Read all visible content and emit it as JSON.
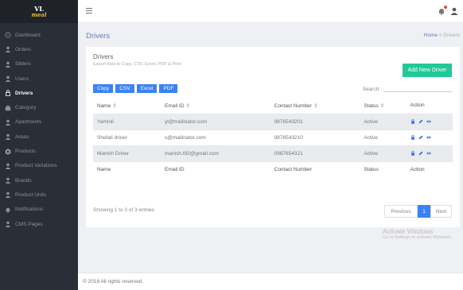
{
  "app": {
    "logo_top": "VL",
    "logo_bottom": "meal"
  },
  "sidebar": {
    "items": [
      {
        "label": "Dashboard",
        "icon": "dashboard-icon"
      },
      {
        "label": "Orders",
        "icon": "user-icon"
      },
      {
        "label": "Sliders",
        "icon": "user-icon"
      },
      {
        "label": "Users",
        "icon": "user-icon"
      },
      {
        "label": "Drivers",
        "icon": "lock-icon",
        "active": true
      },
      {
        "label": "Category",
        "icon": "category-icon"
      },
      {
        "label": "Apartments",
        "icon": "user-icon"
      },
      {
        "label": "Areas",
        "icon": "user-icon"
      },
      {
        "label": "Products",
        "icon": "product-icon"
      },
      {
        "label": "Product Variations",
        "icon": "user-icon"
      },
      {
        "label": "Brands",
        "icon": "user-icon"
      },
      {
        "label": "Product Units",
        "icon": "user-icon"
      },
      {
        "label": "Notifications",
        "icon": "bell-icon"
      },
      {
        "label": "CMS Pages",
        "icon": "user-icon"
      }
    ]
  },
  "page": {
    "title": "Drivers",
    "breadcrumb_home": "Home",
    "breadcrumb_sep": ">",
    "breadcrumb_current": "Drivers"
  },
  "card": {
    "title": "Drivers",
    "subtitle": "Export data to Copy, CSV, Excel, PDF & Print",
    "add_button": "Add New Driver",
    "export_buttons": [
      "Copy",
      "CSV",
      "Excel",
      "PDF"
    ],
    "search_label": "Search:"
  },
  "table": {
    "columns": [
      "Name",
      "Email ID",
      "Contact Number",
      "Status",
      "Action"
    ],
    "rows": [
      {
        "name": "Yaminil",
        "email": "yl@mailinator.com",
        "contact": "9876543201",
        "status": "Active"
      },
      {
        "name": "Shefali driver",
        "email": "s@mailinator.com",
        "contact": "9876543210",
        "status": "Active"
      },
      {
        "name": "Manish Driver",
        "email": "manish.t92@gmail.com",
        "contact": "0987654321",
        "status": "Active"
      }
    ]
  },
  "pagination": {
    "info": "Showing 1 to 3 of 3 entries",
    "prev": "Previous",
    "current": "1",
    "next": "Next"
  },
  "watermark": {
    "line1": "Activate Windows",
    "line2": "Go to Settings to activate Windows."
  },
  "footer": {
    "text": "© 2018 All rights reserved."
  },
  "colors": {
    "accent": "#3b82f6",
    "add_button": "#20c997",
    "sidebar": "#2a2e37"
  }
}
